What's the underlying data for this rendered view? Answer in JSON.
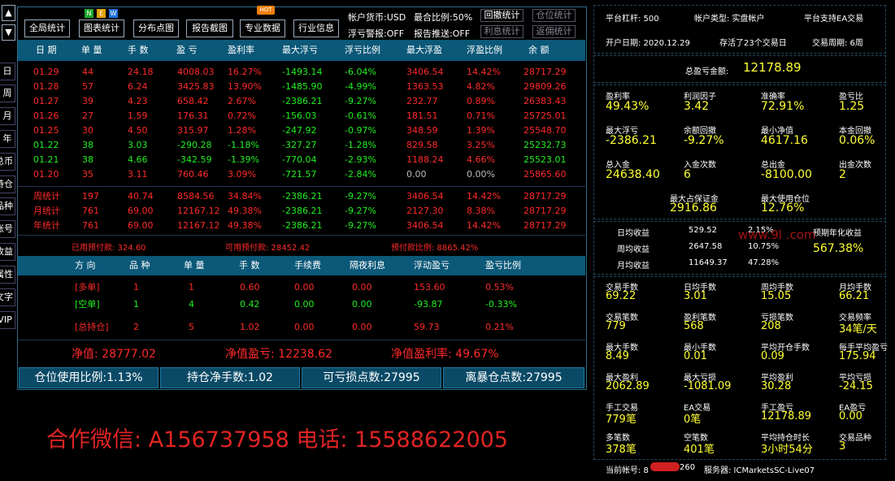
{
  "side_arrows": {
    "up": "▲",
    "down": "▼"
  },
  "vtabs": [
    "日",
    "周",
    "月",
    "年",
    "总币",
    "持仓",
    "品种",
    "账号",
    "收益",
    "属性",
    "文字",
    "VIP"
  ],
  "top_buttons": {
    "global_stats": "全局统计",
    "chart_stats": "图表统计",
    "distribution": "分布点图",
    "report_shot": "报告截图",
    "pro_data": "专业数据",
    "industry": "行业信息"
  },
  "badges": {
    "new": [
      "N",
      "E",
      "W"
    ],
    "hot": "HOT"
  },
  "status": {
    "currency": "帐户货币:USD",
    "margin_ratio": "最合比例:50%",
    "float_alert": "浮亏警报:OFF",
    "report_push": "报告推送:OFF"
  },
  "small_buttons": {
    "drawdown": "回撤统计",
    "position": "仓位统计",
    "interest": "利息统计",
    "rebate": "返佣统计"
  },
  "table": {
    "headers": [
      "日 期",
      "单 量",
      "手 数",
      "盈 亏",
      "盈利率",
      "最大浮亏",
      "浮亏比例",
      "最大浮盈",
      "浮盈比例",
      "余 额"
    ],
    "rows": [
      [
        "01.29",
        "44",
        "24.18",
        "4008.03",
        "16.27%",
        "-1493.14",
        "-6.04%",
        "3406.54",
        "14.42%",
        "28717.29"
      ],
      [
        "01.28",
        "57",
        "6.24",
        "3425.83",
        "13.90%",
        "-1485.90",
        "-4.99%",
        "1363.53",
        "4.82%",
        "29809.26"
      ],
      [
        "01.27",
        "39",
        "4.23",
        "658.42",
        "2.67%",
        "-2386.21",
        "-9.27%",
        "232.77",
        "0.89%",
        "26383.43"
      ],
      [
        "01.26",
        "27",
        "1.59",
        "176.31",
        "0.72%",
        "-156.03",
        "-0.61%",
        "181.51",
        "0.71%",
        "25725.01"
      ],
      [
        "01.25",
        "30",
        "4.50",
        "315.97",
        "1.28%",
        "-247.92",
        "-0.97%",
        "348.59",
        "1.39%",
        "25548.70"
      ],
      [
        "01.22",
        "38",
        "3.03",
        "-290.28",
        "-1.18%",
        "-327.27",
        "-1.28%",
        "829.58",
        "3.25%",
        "25232.73"
      ],
      [
        "01.21",
        "38",
        "4.66",
        "-342.59",
        "-1.39%",
        "-770.04",
        "-2.93%",
        "1188.24",
        "4.66%",
        "25523.01"
      ],
      [
        "01.20",
        "35",
        "3.11",
        "760.46",
        "3.09%",
        "-721.57",
        "-2.84%",
        "0.00",
        "0.00%",
        "25865.60"
      ]
    ],
    "summary": [
      [
        "周统计",
        "197",
        "40.74",
        "8584.56",
        "34.84%",
        "-2386.21",
        "-9.27%",
        "3406.54",
        "14.42%",
        "28717.29"
      ],
      [
        "月统计",
        "761",
        "69.00",
        "12167.12",
        "49.38%",
        "-2386.21",
        "-9.27%",
        "2127.30",
        "8.38%",
        "28717.29"
      ],
      [
        "年统计",
        "761",
        "69.00",
        "12167.12",
        "49.38%",
        "-2386.21",
        "-9.27%",
        "3406.54",
        "14.42%",
        "28717.29"
      ]
    ]
  },
  "prepaid": {
    "used": "已用预付款: 324.60",
    "available": "可用预付款: 28452.42",
    "ratio": "预付款比例: 8865.42%"
  },
  "positions": {
    "headers": [
      "方 向",
      "品 种",
      "单 量",
      "手 数",
      "手续费",
      "隔夜利息",
      "浮动盈亏",
      "盈亏比例"
    ],
    "rows": [
      [
        "[多单]",
        "1",
        "1",
        "0.60",
        "0.00",
        "0.00",
        "153.60",
        "0.53%"
      ],
      [
        "[空单]",
        "1",
        "4",
        "0.42",
        "0.00",
        "0.00",
        "-93.87",
        "-0.33%"
      ],
      [
        "[总持仓]",
        "2",
        "5",
        "1.02",
        "0.00",
        "0.00",
        "59.73",
        "0.21%"
      ]
    ]
  },
  "net": {
    "value": "净值: 28777.02",
    "pnl": "净值盈亏: 12238.62",
    "rate": "净值盈利率: 49.67%"
  },
  "bottom_buttons": [
    "仓位使用比例:1.13%",
    "持仓净手数:1.02",
    "可亏损点数:27995",
    "离暴仓点数:27995"
  ],
  "watermark_contact": "合作微信: A156737958  电话:  15588622005",
  "right": {
    "leverage": "平台杠杆: 500",
    "account_type": "帐户类型: 实盘帐户",
    "ea_support": "平台支持EA交易",
    "open_date": "开户日期: 2020.12.29",
    "survival": "存活了23个交易日",
    "period": "交易周期: 6周",
    "total_profit_label": "总盈亏金额:",
    "total_profit": "12178.89",
    "metrics": [
      {
        "label": "盈利率",
        "value": "49.43%"
      },
      {
        "label": "利润因子",
        "value": "3.42"
      },
      {
        "label": "准确率",
        "value": "72.91%"
      },
      {
        "label": "盈亏比",
        "value": "1.25"
      },
      {
        "label": "最大浮亏",
        "value": "-2386.21"
      },
      {
        "label": "余额回撤",
        "value": "-9.27%"
      },
      {
        "label": "最小净值",
        "value": "4617.16"
      },
      {
        "label": "本金回撤",
        "value": "0.06%"
      },
      {
        "label": "总入金",
        "value": "24638.40"
      },
      {
        "label": "入金次数",
        "value": "6"
      },
      {
        "label": "总出金",
        "value": "-8100.00"
      },
      {
        "label": "出金次数",
        "value": "2"
      }
    ],
    "margin": [
      {
        "label": "最大占保证金",
        "value": "2916.86"
      },
      {
        "label": "最大使用仓位",
        "value": "12.76%"
      }
    ],
    "yields": [
      {
        "label": "日均收益",
        "value": "529.52",
        "pct": "2.15%"
      },
      {
        "label": "周均收益",
        "value": "2647.58",
        "pct": "10.75%"
      },
      {
        "label": "月均收益",
        "value": "11649.37",
        "pct": "47.28%"
      }
    ],
    "annual_label": "预期年化收益",
    "annual_value": "567.38%",
    "stats": [
      {
        "label": "交易手数",
        "value": "69.22"
      },
      {
        "label": "日均手数",
        "value": "3.01"
      },
      {
        "label": "周均手数",
        "value": "15.05"
      },
      {
        "label": "月均手数",
        "value": "66.21"
      },
      {
        "label": "交易笔数",
        "value": "779"
      },
      {
        "label": "盈利笔数",
        "value": "568"
      },
      {
        "label": "亏损笔数",
        "value": "208"
      },
      {
        "label": "交易频率",
        "value": "34笔/天"
      },
      {
        "label": "最大手数",
        "value": "8.49"
      },
      {
        "label": "最小手数",
        "value": "0.01"
      },
      {
        "label": "平均开仓手数",
        "value": "0.09"
      },
      {
        "label": "每手平均盈亏",
        "value": "175.94"
      },
      {
        "label": "最大盈利",
        "value": "2062.89"
      },
      {
        "label": "最大亏损",
        "value": "-1081.09"
      },
      {
        "label": "平均盈利",
        "value": "30.28"
      },
      {
        "label": "平均亏损",
        "value": "-24.15"
      },
      {
        "label": "手工交易",
        "value": "779笔"
      },
      {
        "label": "EA交易",
        "value": "0笔"
      },
      {
        "label": "手工盈亏",
        "value": "12178.89"
      },
      {
        "label": "EA盈亏",
        "value": "0.00"
      },
      {
        "label": "多笔数",
        "value": "378笔"
      },
      {
        "label": "空笔数",
        "value": "401笔"
      },
      {
        "label": "平均持仓时长",
        "value": "3小时54分"
      },
      {
        "label": "交易品种",
        "value": "3"
      }
    ],
    "account_label": "当前帐号: 8",
    "account_tail": "260",
    "server": "服务器: ICMarketsSC-Live07",
    "watermark": "www.9l        .com"
  },
  "colors": {
    "header_bg": "#0b5878",
    "red": "#ff2a2a",
    "green": "#22ee22",
    "yellow": "#ffff33"
  }
}
